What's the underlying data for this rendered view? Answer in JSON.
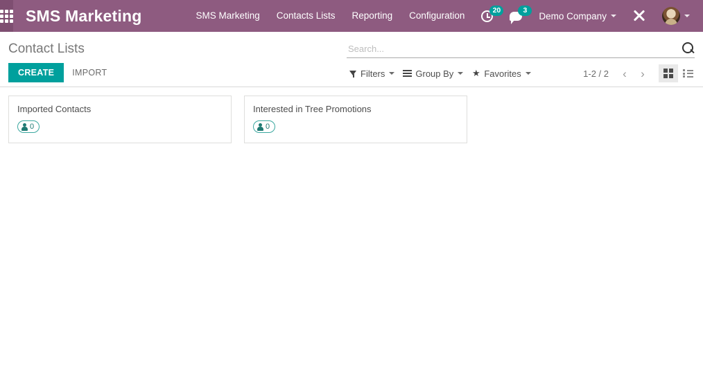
{
  "navbar": {
    "apps_icon": "apps-grid-icon",
    "brand": "SMS Marketing",
    "menu": [
      {
        "label": "SMS Marketing"
      },
      {
        "label": "Contacts Lists"
      },
      {
        "label": "Reporting"
      },
      {
        "label": "Configuration"
      }
    ],
    "systray": {
      "activity_icon": "clock-activity-icon",
      "activity_count": "20",
      "messages_icon": "chat-bubble-icon",
      "messages_count": "3",
      "company": "Demo Company",
      "tools_icon": "tools-icon",
      "avatar_icon": "user-avatar"
    },
    "colors": {
      "background": "#8e5b80",
      "apps_background": "#7e4e71",
      "badge": "#00a09d"
    }
  },
  "control_panel": {
    "breadcrumb": "Contact Lists",
    "create_label": "CREATE",
    "import_label": "IMPORT",
    "search": {
      "placeholder": "Search...",
      "value": "",
      "icon": "search-icon"
    },
    "filters": [
      {
        "label": "Filters",
        "icon": "funnel-icon"
      },
      {
        "label": "Group By",
        "icon": "lines-icon"
      },
      {
        "label": "Favorites",
        "icon": "star-icon"
      }
    ],
    "pager": {
      "range": "1-2 / 2",
      "previous_icon": "chevron-left-icon",
      "previous_glyph": "‹",
      "next_icon": "chevron-right-icon",
      "next_glyph": "›"
    },
    "views": [
      {
        "name": "kanban",
        "icon": "kanban-view-icon",
        "active": true
      },
      {
        "name": "list",
        "icon": "list-view-icon",
        "active": false
      }
    ],
    "colors": {
      "primary": "#00a09d"
    }
  },
  "kanban": {
    "cards": [
      {
        "title": "Imported Contacts",
        "contacts_count": "0",
        "badge_icon": "person-icon"
      },
      {
        "title": "Interested in Tree Promotions",
        "contacts_count": "0",
        "badge_icon": "person-icon"
      }
    ]
  },
  "icons": {
    "star_glyph": "★"
  }
}
